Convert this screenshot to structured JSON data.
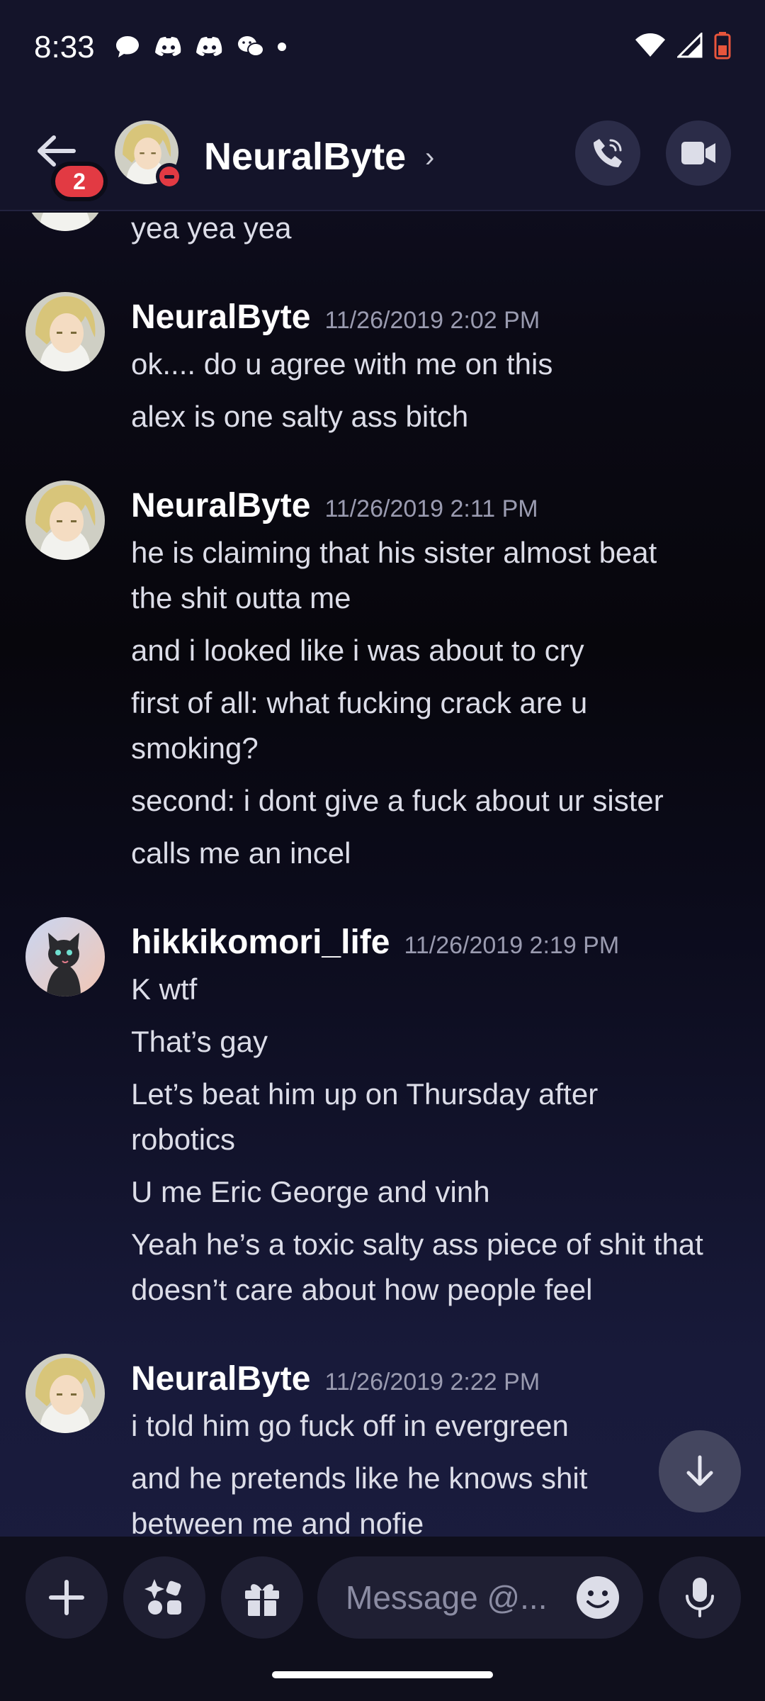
{
  "status_bar": {
    "time": "8:33",
    "notification_icons": [
      "chat-bubble-icon",
      "discord-icon",
      "discord-icon",
      "wechat-icon"
    ],
    "system_icons": [
      "wifi-icon",
      "cell-signal-icon",
      "battery-low-icon"
    ]
  },
  "header": {
    "unread_badge": "2",
    "contact_name": "NeuralByte",
    "status": "do-not-disturb",
    "chevron": "›"
  },
  "messages": {
    "partial_top": "yea yea yea",
    "groups": [
      {
        "author": "NeuralByte",
        "timestamp": "11/26/2019 2:02 PM",
        "lines": [
          "ok.... do u agree with me on this",
          "alex is one salty ass bitch"
        ]
      },
      {
        "author": "NeuralByte",
        "timestamp": "11/26/2019 2:11 PM",
        "lines": [
          "he is claiming that his sister almost beat",
          "the shit outta me",
          "and i looked like i was about to cry",
          "first of all: what fucking crack are u",
          "smoking?",
          "second: i dont give a fuck about ur sister",
          "calls me an incel"
        ]
      },
      {
        "author": "hikkikomori_life",
        "timestamp": "11/26/2019 2:19 PM",
        "lines": [
          "K wtf",
          "That’s gay",
          "Let’s beat him up on Thursday after",
          "robotics",
          "U me Eric George and vinh",
          "Yeah he’s a toxic salty ass piece of shit that",
          "doesn’t care about how people feel"
        ]
      },
      {
        "author": "NeuralByte",
        "timestamp": "11/26/2019 2:22 PM",
        "lines": [
          "i told him go fuck off in evergreen",
          "and he pretends like he knows shit",
          "between me and nofie"
        ]
      }
    ]
  },
  "composer": {
    "placeholder": "Message @..."
  },
  "colors": {
    "accent_red": "#e23a43",
    "header_bg": "#14142a",
    "timestamp": "#9a9bb0"
  }
}
